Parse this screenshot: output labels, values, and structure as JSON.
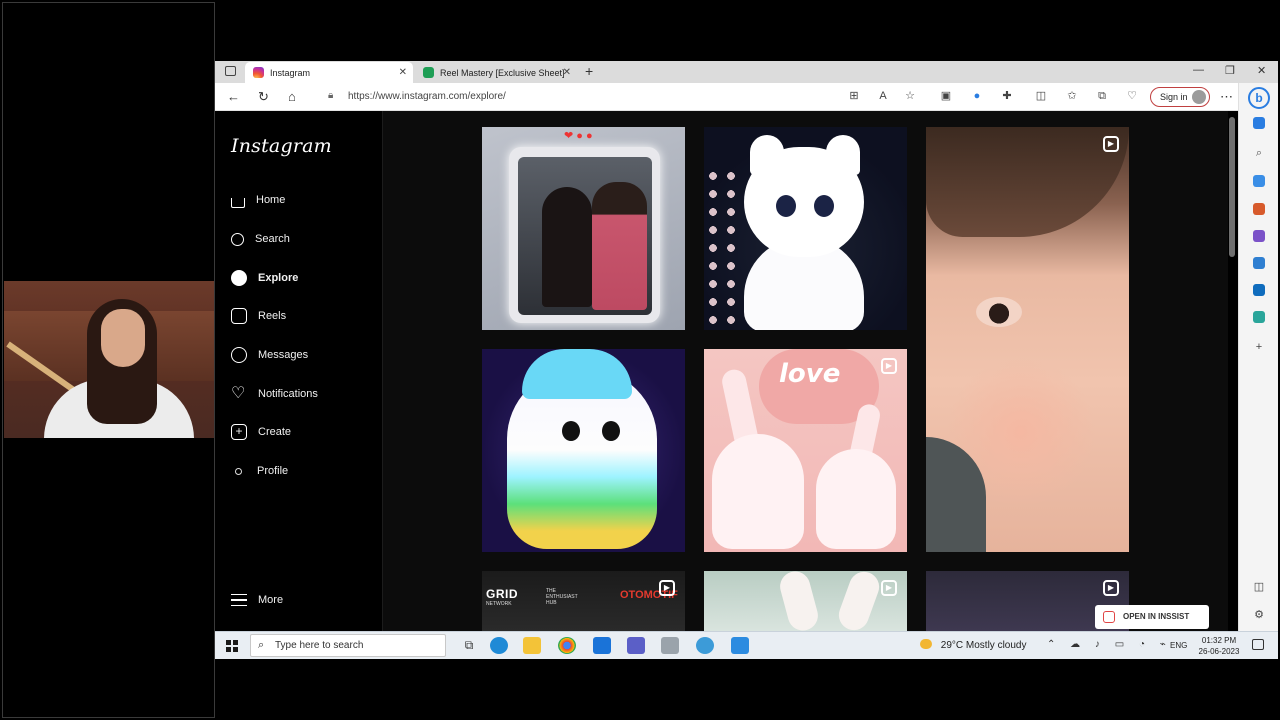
{
  "browser": {
    "tabs": [
      {
        "label": "Instagram",
        "active": true
      },
      {
        "label": "Reel Mastery [Exclusive Sheet]",
        "active": false
      }
    ],
    "url": "https://www.instagram.com/explore/",
    "signin_label": "Sign in",
    "new_tab_symbol": "+",
    "close_symbol": "✕",
    "minimize_symbol": "—",
    "maximize_symbol": "❐"
  },
  "instagram": {
    "logo": "Instagram",
    "nav": [
      {
        "label": "Home",
        "icon": "home-icon"
      },
      {
        "label": "Search",
        "icon": "search-icon"
      },
      {
        "label": "Explore",
        "icon": "explore-icon",
        "active": true
      },
      {
        "label": "Reels",
        "icon": "reels-icon"
      },
      {
        "label": "Messages",
        "icon": "messages-icon"
      },
      {
        "label": "Notifications",
        "icon": "heart-icon"
      },
      {
        "label": "Create",
        "icon": "create-icon"
      },
      {
        "label": "Profile",
        "icon": "profile-icon"
      }
    ],
    "more_label": "More",
    "tiles": {
      "love_text": "love",
      "grid_logo": "GRID",
      "grid_sub_1": "THE",
      "grid_sub_2": "ENTHUSIAST",
      "grid_sub_3": "HUB",
      "grid_network": "NETWORK",
      "otom_text": "OTOMOTIF"
    },
    "inssist_label": "OPEN IN INSSIST"
  },
  "taskbar": {
    "search_placeholder": "Type here to search",
    "weather": "29°C  Mostly cloudy",
    "language": "ENG",
    "time": "01:32 PM",
    "date": "26-06-2023"
  },
  "colors": {
    "ig_bg": "#000000",
    "grid_bg": "#0c0c0c",
    "signin_border": "#c04040",
    "bing_blue": "#2a7de1",
    "taskbar_bg": "#e9eef3"
  }
}
